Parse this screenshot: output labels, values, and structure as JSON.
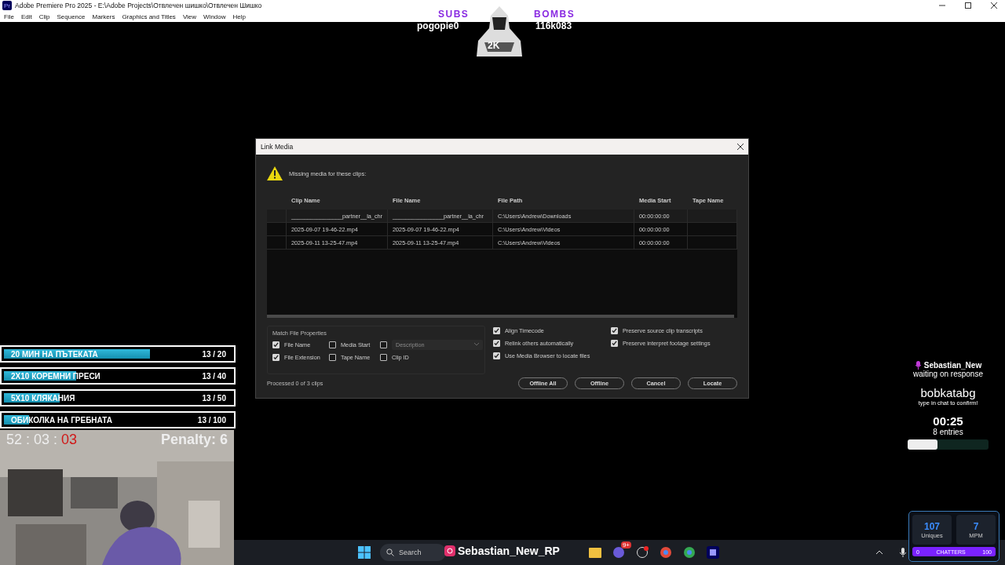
{
  "window": {
    "title": "Adobe Premiere Pro 2025 - E:\\Adobe Projects\\Отвлечен шишко\\Отвлечен Шишко",
    "app_badge": "Pr"
  },
  "menu": [
    "File",
    "Edit",
    "Clip",
    "Sequence",
    "Markers",
    "Graphics and Titles",
    "View",
    "Window",
    "Help"
  ],
  "stream_top": {
    "subs_label": "SUBS",
    "subs_name": "pogopie0",
    "bombs_label": "BOMBS",
    "bombs_name": "116k083",
    "badge": "2K"
  },
  "dialog": {
    "title": "Link Media",
    "message": "Missing media for these clips:",
    "columns": [
      "Clip Name",
      "File Name",
      "File Path",
      "Media Start",
      "Tape Name"
    ],
    "rows": [
      {
        "selected": true,
        "cells": [
          "________________partner__la_chr",
          "________________partner__la_chr",
          "C:\\Users\\Andrew\\Downloads",
          "00:00:00:00",
          ""
        ]
      },
      {
        "selected": false,
        "cells": [
          "2025-09-07 19-46-22.mp4",
          "2025-09-07 19-46-22.mp4",
          "C:\\Users\\Andrew\\Videos",
          "00:00:00:00",
          ""
        ]
      },
      {
        "selected": false,
        "cells": [
          "2025-09-11 13-25-47.mp4",
          "2025-09-11 13-25-47.mp4",
          "C:\\Users\\Andrew\\Videos",
          "00:00:00:00",
          ""
        ]
      }
    ],
    "match_group": "Match File Properties",
    "match_options": [
      {
        "kind": "checkbox",
        "label": "File Name",
        "checked": true
      },
      {
        "kind": "checkbox",
        "label": "Media Start",
        "checked": false
      },
      {
        "kind": "dropdown",
        "placeholder": "Description",
        "checked": false
      },
      {
        "kind": "checkbox",
        "label": "File Extension",
        "checked": true
      },
      {
        "kind": "checkbox",
        "label": "Tape Name",
        "checked": false
      },
      {
        "kind": "checkbox",
        "label": "Clip ID",
        "checked": false
      }
    ],
    "options_left": [
      {
        "label": "Align Timecode",
        "checked": true
      },
      {
        "label": "Relink others automatically",
        "checked": true
      },
      {
        "label": "Use Media Browser to locate files",
        "checked": true
      }
    ],
    "options_right": [
      {
        "label": "Preserve source clip transcripts",
        "checked": true
      },
      {
        "label": "Preserve interpret footage settings",
        "checked": true
      }
    ],
    "status": "Processed 0 of 3 clips",
    "buttons": [
      "Offline All",
      "Offline",
      "Cancel",
      "Locate"
    ]
  },
  "goals": [
    {
      "label": "20 МИН НА ПЪТЕКАТА",
      "count": "13 / 20",
      "level": 0.65
    },
    {
      "label": "2X10 КОРЕМНИ ПРЕСИ",
      "count": "13 / 40",
      "level": 0.33
    },
    {
      "label": "5X10 КЛЯКАНИЯ",
      "count": "13 / 50",
      "level": 0.26
    },
    {
      "label": "ОБИКОЛКА НА ГРЕБНАТА",
      "count": "13 / 100",
      "level": 0.13
    }
  ],
  "timer": {
    "parts": [
      "52",
      "03",
      "03"
    ],
    "separator": ":",
    "penalty": "Penalty: 6"
  },
  "giveaway": {
    "user": "Sebastian_New",
    "status": "waiting on response",
    "winner": "bobkatabg",
    "hint": "type in chat to confirm!",
    "time": "00:25",
    "entries": "8 entries",
    "level": 0.37
  },
  "stats": {
    "uniques": "107",
    "uniques_label": "Uniques",
    "mpm": "7",
    "mpm_label": "MPM",
    "bar_min": "0",
    "bar_label": "CHATTERS",
    "bar_max": "100"
  },
  "taskbar": {
    "search": "Search",
    "overlay_name": "Sebastian_New_RP",
    "notification": "9+"
  }
}
